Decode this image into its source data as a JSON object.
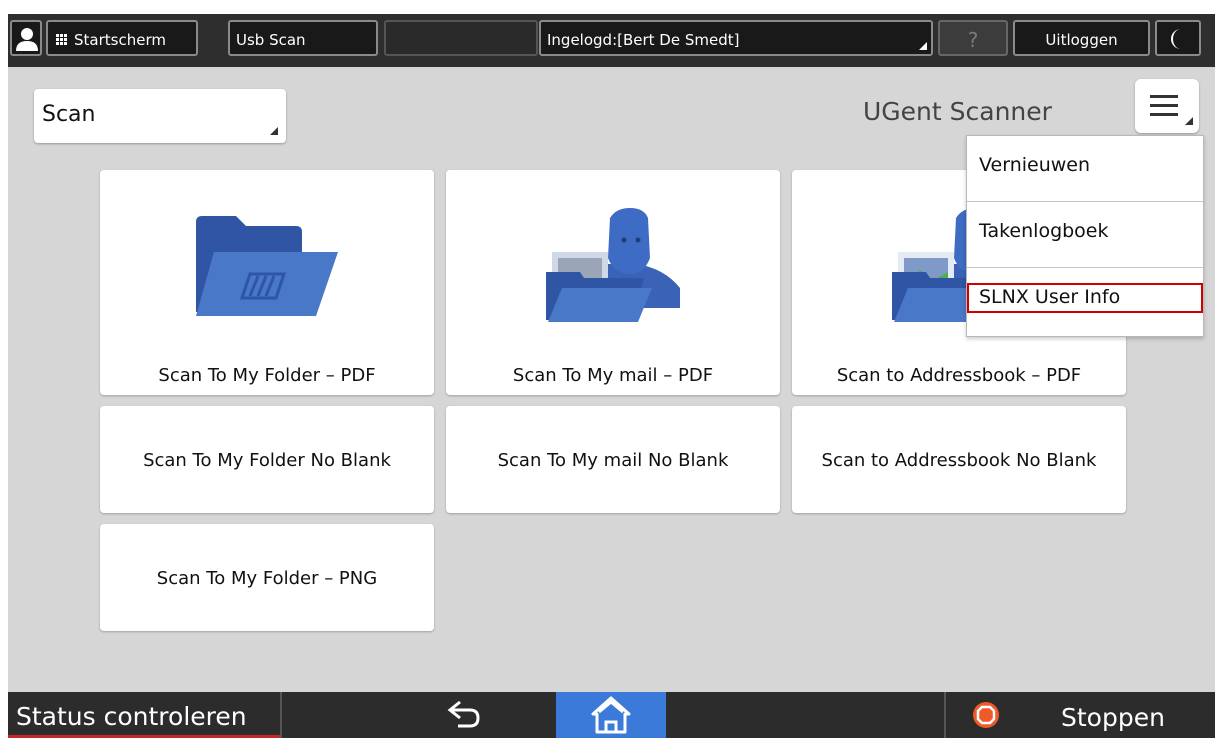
{
  "topbar": {
    "home_label": "Startscherm",
    "usb_label": "Usb Scan",
    "login_label": "Ingelogd:[Bert De Smedt]",
    "help_label": "?",
    "logout_label": "Uitloggen"
  },
  "main": {
    "mode_select_value": "Scan",
    "app_title": "UGent Scanner"
  },
  "menu": {
    "items": [
      {
        "label": "Vernieuwen"
      },
      {
        "label": "Takenlogboek"
      },
      {
        "label": "SLNX User Info"
      }
    ],
    "highlight_color": "#d10000"
  },
  "tiles": [
    {
      "label": "Scan To My Folder – PDF",
      "icon": "folder-icon"
    },
    {
      "label": "Scan To My mail – PDF",
      "icon": "user-mail-icon"
    },
    {
      "label": "Scan to Addressbook – PDF",
      "icon": "addressbook-icon"
    },
    {
      "label": "Scan To My Folder No Blank"
    },
    {
      "label": "Scan To My mail No Blank"
    },
    {
      "label": "Scan to Addressbook No Blank"
    },
    {
      "label": "Scan To My Folder – PNG"
    }
  ],
  "bottombar": {
    "status_label": "Status controleren",
    "stop_label": "Stoppen",
    "home_color": "#3b7ad8",
    "stop_color": "#f05a28"
  }
}
